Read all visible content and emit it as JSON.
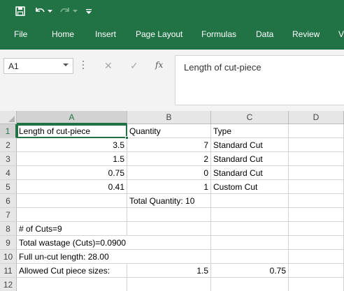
{
  "app": {
    "accent": "#217346",
    "qat_icons": [
      "save-icon",
      "undo-icon",
      "undo-dropdown-icon",
      "redo-icon",
      "redo-dropdown-icon",
      "customize-qat-icon"
    ]
  },
  "ribbon": {
    "tabs": [
      "File",
      "Home",
      "Insert",
      "Page Layout",
      "Formulas",
      "Data",
      "Review",
      "V"
    ]
  },
  "formula_bar": {
    "name_box": "A1",
    "cancel_glyph": "✕",
    "enter_glyph": "✓",
    "fx_label": "fx",
    "content": "Length of cut-piece"
  },
  "sheet": {
    "selected_cell": "A1",
    "columns": [
      "A",
      "B",
      "C",
      "D"
    ],
    "rows": [
      "1",
      "2",
      "3",
      "4",
      "5",
      "6",
      "7",
      "8",
      "9",
      "10",
      "11",
      "12"
    ],
    "cells": {
      "A1": "Length of cut-piece",
      "B1": "Quantity",
      "C1": "Type",
      "A2": "3.5",
      "B2": "7",
      "C2": "Standard Cut",
      "A3": "1.5",
      "B3": "2",
      "C3": "Standard Cut",
      "A4": "0.75",
      "B4": "0",
      "C4": "Standard Cut",
      "A5": "0.41",
      "B5": "1",
      "C5": "Custom Cut",
      "B6": "Total Quantity: 10",
      "A8": "# of Cuts=9",
      "A9": "Total wastage (Cuts)=0.0900",
      "A10": "Full un-cut length: 28.00",
      "A11": "Allowed Cut piece sizes:",
      "B11": "1.5",
      "C11": "0.75"
    }
  }
}
